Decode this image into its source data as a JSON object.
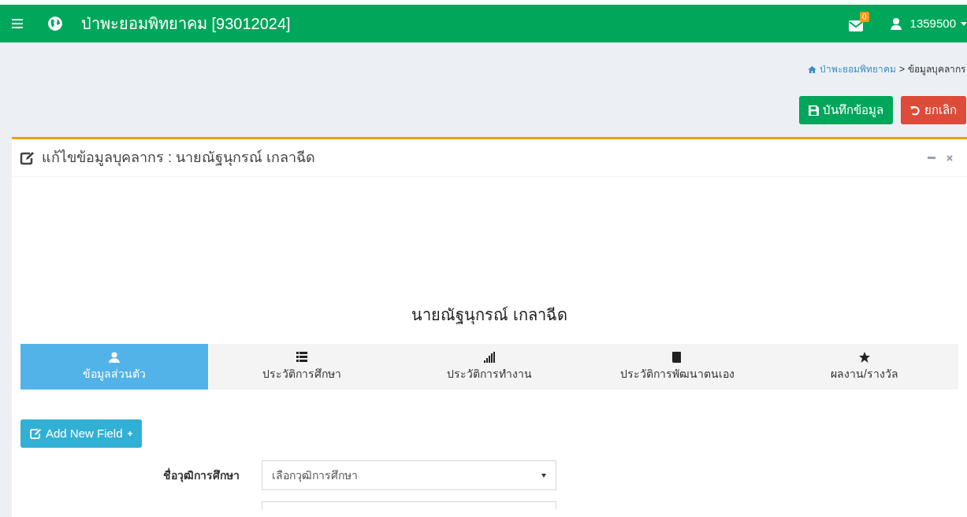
{
  "header": {
    "title": "ป่าพะยอมพิทยาคม [93012024]",
    "mail_count": "0",
    "user": "1359500"
  },
  "breadcrumb": [
    {
      "label": "ป่าพะยอมพิทยาคม",
      "kind": "link"
    },
    {
      "label": "ข้อมูลบุคลากร",
      "kind": "current"
    }
  ],
  "breadcrumb_separator": ">",
  "actions": [
    {
      "label": "บันทึกข้อมูล",
      "kind": "save"
    },
    {
      "label": "ยกเลิก",
      "kind": "cancel"
    }
  ],
  "panel": {
    "title": "แก้ไขข้อมูลบุคลากร : นายณัฐนุกรณ์ เกลาฉีด",
    "person_name": "นายณัฐนุกรณ์ เกลาฉีด"
  },
  "tabs": [
    {
      "label": "ข้อมูลส่วนตัว",
      "selected": true
    },
    {
      "label": "ประวัติการศึกษา",
      "selected": false
    },
    {
      "label": "ประวัติการทำงาน",
      "selected": false
    },
    {
      "label": "ประวัติการพัฒนาตนเอง",
      "selected": false
    },
    {
      "label": "ผลงาน/รางวัล",
      "selected": false
    }
  ],
  "add_button": {
    "label": "Add New Field"
  },
  "form": [
    {
      "label": "ชื่อวุฒิการศึกษา",
      "value": "เลือกวุฒิการศึกษา"
    }
  ]
}
